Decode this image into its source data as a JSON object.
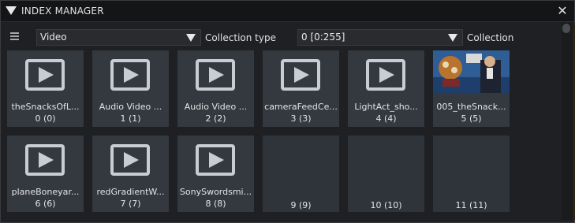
{
  "window": {
    "title": "INDEX MANAGER",
    "close_symbol": "✕"
  },
  "toolbar": {
    "menu_icon": "hamburger-icon",
    "collection_type": {
      "value": "Video",
      "label": "Collection type"
    },
    "collection": {
      "value": "0 [0:255]",
      "label": "Collection"
    }
  },
  "items": [
    {
      "name": "theSnacksOfL...",
      "index": "0 (0)",
      "kind": "video"
    },
    {
      "name": "Audio Video ...",
      "index": "1 (1)",
      "kind": "video"
    },
    {
      "name": "Audio Video ...",
      "index": "2 (2)",
      "kind": "video"
    },
    {
      "name": "cameraFeedCe...",
      "index": "3 (3)",
      "kind": "video"
    },
    {
      "name": "LightAct_sho...",
      "index": "4 (4)",
      "kind": "video"
    },
    {
      "name": "005_theSnack...",
      "index": "5 (5)",
      "kind": "thumbnail"
    },
    {
      "name": "planeBoneyar...",
      "index": "6 (6)",
      "kind": "video"
    },
    {
      "name": "redGradientW...",
      "index": "7 (7)",
      "kind": "video"
    },
    {
      "name": "SonySwordsmi...",
      "index": "8 (8)",
      "kind": "video"
    },
    {
      "name": "",
      "index": "9 (9)",
      "kind": "empty"
    },
    {
      "name": "",
      "index": "10 (10)",
      "kind": "empty"
    },
    {
      "name": "",
      "index": "11 (11)",
      "kind": "empty"
    }
  ],
  "colors": {
    "tile": "#34383f",
    "icon": "#c9ccd2",
    "background": "#1f2023"
  }
}
